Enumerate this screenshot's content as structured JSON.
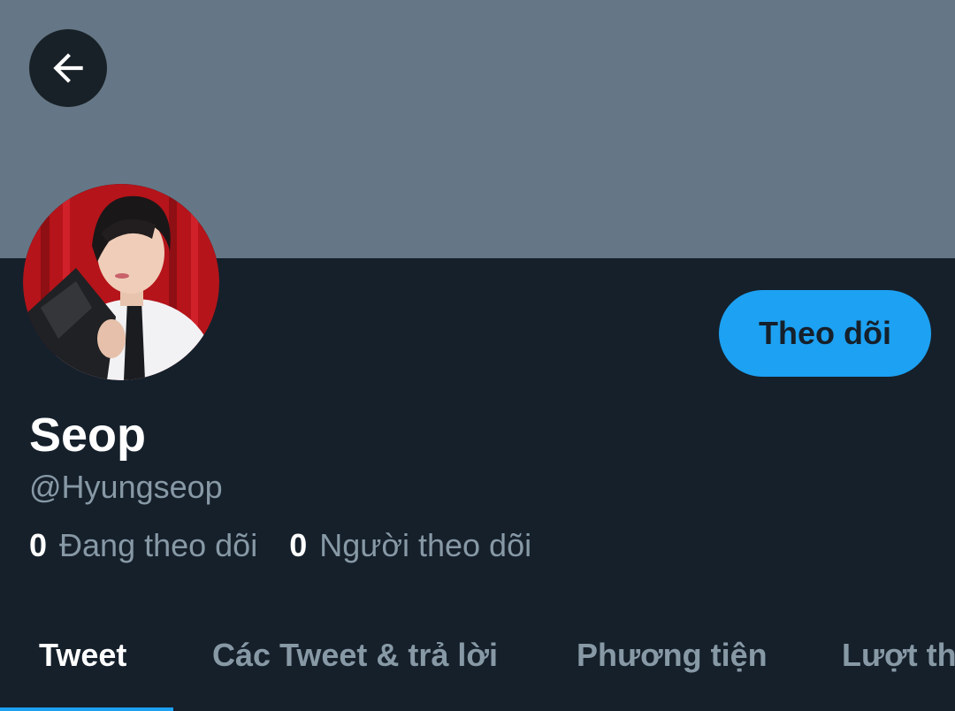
{
  "header": {
    "back_icon": "arrow-left-icon",
    "banner_color": "#657786"
  },
  "profile": {
    "display_name": "Seop",
    "handle": "@Hyungseop",
    "follow_button_label": "Theo dõi",
    "avatar_icon": "profile-photo"
  },
  "stats": {
    "following_count": "0",
    "following_label": "Đang theo dõi",
    "followers_count": "0",
    "followers_label": "Người theo dõi"
  },
  "tabs": [
    {
      "label": "Tweet",
      "active": true
    },
    {
      "label": "Các Tweet & trả lời",
      "active": false
    },
    {
      "label": "Phương tiện",
      "active": false
    },
    {
      "label": "Lượt thích",
      "active": false
    }
  ],
  "colors": {
    "background": "#15202b",
    "accent": "#1da1f2",
    "secondary_text": "#8899a6"
  }
}
